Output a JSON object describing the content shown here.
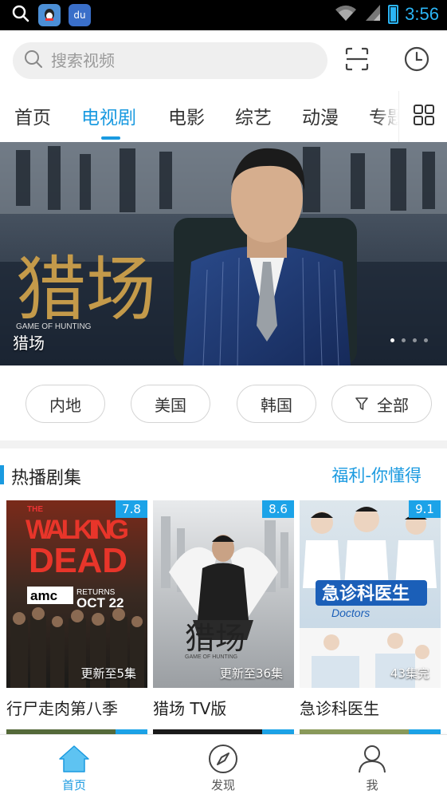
{
  "status_bar": {
    "time": "3:56",
    "app_icons": [
      "qq-icon",
      "baidu-icon"
    ],
    "baidu_text": "du"
  },
  "search": {
    "placeholder": "搜索视频"
  },
  "tabs": [
    {
      "label": "首页",
      "active": false
    },
    {
      "label": "电视剧",
      "active": true
    },
    {
      "label": "电影",
      "active": false
    },
    {
      "label": "综艺",
      "active": false
    },
    {
      "label": "动漫",
      "active": false
    },
    {
      "label": "专题",
      "active": false
    }
  ],
  "banner": {
    "title": "猎场",
    "poster_text": "猎场",
    "poster_subtitle": "GAME OF HUNTING",
    "page_count": 4,
    "current_page": 1
  },
  "filters": [
    {
      "label": "内地"
    },
    {
      "label": "美国"
    },
    {
      "label": "韩国"
    },
    {
      "label": "全部",
      "icon": "filter-icon"
    }
  ],
  "section": {
    "title": "热播剧集",
    "link": "福利-你懂得"
  },
  "cards": [
    {
      "title": "行尸走肉第八季",
      "score": "7.8",
      "progress": "更新至5集",
      "poster": {
        "line1": "THE",
        "line2": "WALKING",
        "line3": "DEAD",
        "network": "amc",
        "returns": "RETURNS",
        "date": "OCT 22"
      }
    },
    {
      "title": "猎场 TV版",
      "score": "8.6",
      "progress": "更新至36集",
      "poster": {
        "line1": "猎场",
        "line2": "GAME OF HUNTING"
      }
    },
    {
      "title": "急诊科医生",
      "score": "9.1",
      "progress": "43集完",
      "poster": {
        "line1": "急诊科医生",
        "line2": "Doctors"
      }
    }
  ],
  "bottom_nav": [
    {
      "label": "首页",
      "icon": "home-icon",
      "active": true
    },
    {
      "label": "发现",
      "icon": "compass-icon",
      "active": false
    },
    {
      "label": "我",
      "icon": "user-icon",
      "active": false
    }
  ],
  "colors": {
    "accent": "#1a9ae0",
    "score_badge": "#1ca3e8",
    "status_bar": "#000000"
  }
}
